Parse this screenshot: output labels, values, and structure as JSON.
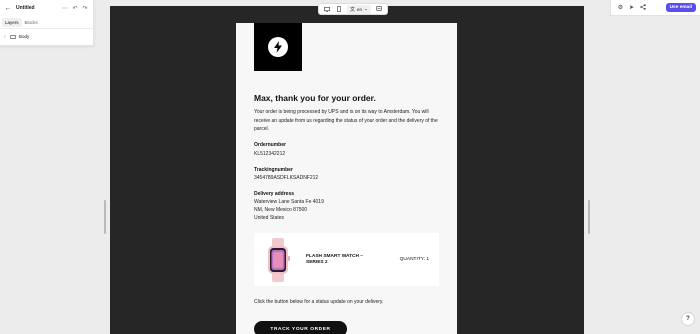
{
  "editor": {
    "document_title": "Untitled",
    "tabs": [
      {
        "label": "Layers",
        "active": true
      },
      {
        "label": "Blocks",
        "active": false
      }
    ],
    "tree_root_label": "Body",
    "icons": {
      "back": "arrow-left-icon",
      "more": "more-horizontal-icon",
      "undo": "undo-icon",
      "redo": "redo-icon"
    }
  },
  "toolbar": {
    "language": "en",
    "icons": [
      "desktop-preview-icon",
      "mobile-preview-icon",
      "language-icon",
      "comment-icon"
    ]
  },
  "right_panel": {
    "icons": [
      "settings-icon",
      "send-icon",
      "share-icon"
    ],
    "primary_button_label": "Use email",
    "accent_color": "#5b4ef0"
  },
  "email": {
    "brand_icon": "lightning-bolt-icon",
    "headline": "Max, thank you for your order.",
    "intro": "Your order is being processed by UPS and is on its way to Amsterdam. You will receive an update from us regarding the status of your order and the delivery of the parcel.",
    "order_number_label": "Ordernumber",
    "order_number": "KL512342212",
    "tracking_label": "Trackingnumber",
    "tracking_number": "3454789ASDFLKSADNF212",
    "address_label": "Delivery address",
    "address_line1": "Waterview Lane Santa Fe 4019",
    "address_line2": "NM, New Mexico 87500",
    "address_line3": "United States",
    "product": {
      "name": "FLASH SMART WATCH – SERIES 2",
      "quantity": "QUANTITY: 1",
      "image_icon": "smart-watch-icon"
    },
    "status_text": "Click the button below for a status update on your delivery.",
    "cta_label": "TRACK YOUR ORDER"
  },
  "help_label": "?"
}
